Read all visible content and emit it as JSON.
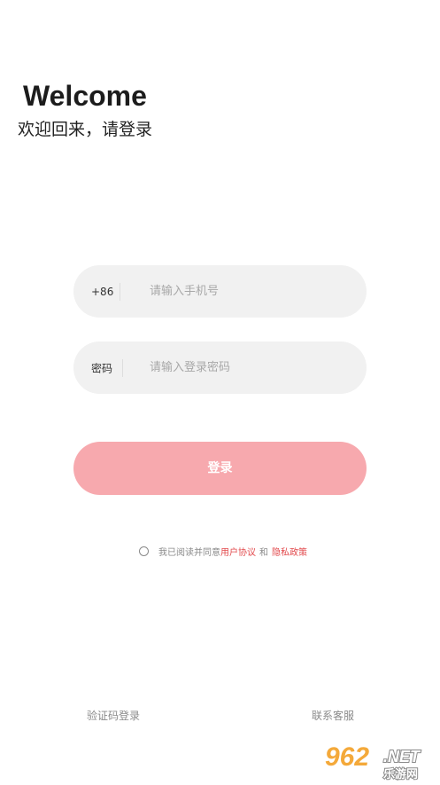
{
  "header": {
    "title": "Welcome",
    "subtitle": "欢迎回来，请登录"
  },
  "phone_field": {
    "prefix": "+86",
    "placeholder": "请输入手机号",
    "value": ""
  },
  "password_field": {
    "prefix": "密码",
    "placeholder": "请输入登录密码",
    "value": ""
  },
  "login_button": {
    "label": "登录"
  },
  "agreement": {
    "checked": false,
    "text": "我已阅读并同意",
    "user_agreement": "用户协议",
    "and": "和",
    "privacy_policy": "隐私政策"
  },
  "footer": {
    "code_login": "验证码登录",
    "customer_service": "联系客服"
  },
  "watermark": {
    "number": "962",
    "domain": ".NET",
    "subtitle": "乐游网"
  },
  "colors": {
    "button": "#f7a9ae",
    "link": "#e2494c",
    "field_bg": "#f1f1f1"
  }
}
